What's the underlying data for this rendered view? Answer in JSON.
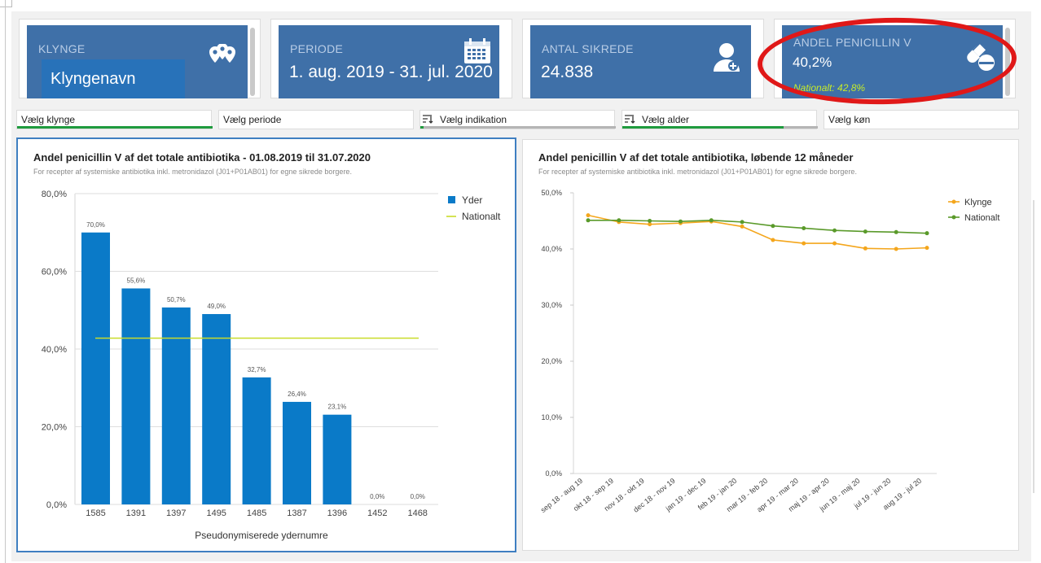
{
  "cards": [
    {
      "title": "KLYNGE",
      "value": "",
      "icon": "map-pins-icon"
    },
    {
      "title": "PERIODE",
      "value": "1. aug. 2019 - 31. jul. 2020",
      "icon": "calendar-icon"
    },
    {
      "title": "ANTAL SIKREDE",
      "value": "24.838",
      "icon": "user-plus-icon"
    },
    {
      "title": "ANDEL PENICILLIN V",
      "value": "40,2%",
      "sub": "Nationalt: 42,8%",
      "icon": "pills-icon"
    }
  ],
  "klynge_overlay": "Klyngenavn",
  "filters": [
    {
      "label": "Vælg klynge",
      "icon": ""
    },
    {
      "label": "Vælg periode",
      "icon": ""
    },
    {
      "label": "Vælg indikation",
      "icon": "filter-lines-icon"
    },
    {
      "label": "Vælg alder",
      "icon": "filter-lines-icon"
    },
    {
      "label": "Vælg køn",
      "icon": ""
    }
  ],
  "colors": {
    "card_bg": "#3f70a8",
    "bar": "#0a7ac8",
    "national_line": "#c9dc2a",
    "klynge_line": "#f4a61c",
    "national_series": "#5a9a2a",
    "highlight": "#e01818",
    "filter_green": "#1f9b3e"
  },
  "left_panel": {
    "title": "Andel penicillin V af det totale antibiotika - 01.08.2019 til 31.07.2020",
    "subtitle": "For recepter af systemiske antibiotika inkl. metronidazol (J01+P01AB01) for egne sikrede borgere."
  },
  "right_panel": {
    "title": "Andel penicillin V af det totale antibiotika, løbende 12 måneder",
    "subtitle": "For recepter af systemiske antibiotika inkl. metronidazol (J01+P01AB01) for egne sikrede borgere."
  },
  "chart_data": [
    {
      "type": "bar",
      "categories": [
        "1585",
        "1391",
        "1397",
        "1495",
        "1485",
        "1387",
        "1396",
        "1452",
        "1468"
      ],
      "series": [
        {
          "name": "Yder",
          "values": [
            70.0,
            55.6,
            50.7,
            49.0,
            32.7,
            26.4,
            23.1,
            0.0,
            0.0
          ]
        },
        {
          "name": "Nationalt",
          "values": [
            42.8
          ]
        }
      ],
      "data_labels": [
        "70,0%",
        "55,6%",
        "50,7%",
        "49,0%",
        "32,7%",
        "26,4%",
        "23,1%",
        "0,0%",
        "0,0%"
      ],
      "y_ticks": [
        "0,0%",
        "20,0%",
        "40,0%",
        "60,0%",
        "80,0%"
      ],
      "xlabel": "Pseudonymiserede ydernumre",
      "ylim": [
        0,
        80
      ],
      "legend_position": "top-right",
      "grid": true
    },
    {
      "type": "line",
      "x": [
        "sep 18 - aug 19",
        "okt 18 - sep 19",
        "nov 18 - okt 19",
        "dec 18 - nov 19",
        "jan 19 - dec 19",
        "feb 19 - jan 20",
        "mar 19 - feb 20",
        "apr 19 - mar 20",
        "maj 19 - apr 20",
        "jun 19 - maj 20",
        "jul 19 - jun 20",
        "aug 19 - jul 20"
      ],
      "series": [
        {
          "name": "Klynge",
          "values": [
            46.0,
            44.8,
            44.4,
            44.6,
            44.9,
            44.0,
            41.6,
            41.0,
            41.0,
            40.1,
            40.0,
            40.2
          ]
        },
        {
          "name": "Nationalt",
          "values": [
            45.1,
            45.1,
            45.0,
            44.9,
            45.1,
            44.8,
            44.1,
            43.7,
            43.3,
            43.1,
            43.0,
            42.8
          ]
        }
      ],
      "y_ticks": [
        "0,0%",
        "10,0%",
        "20,0%",
        "30,0%",
        "40,0%",
        "50,0%"
      ],
      "ylim": [
        0,
        50
      ],
      "legend_position": "top-right",
      "grid": false
    }
  ]
}
